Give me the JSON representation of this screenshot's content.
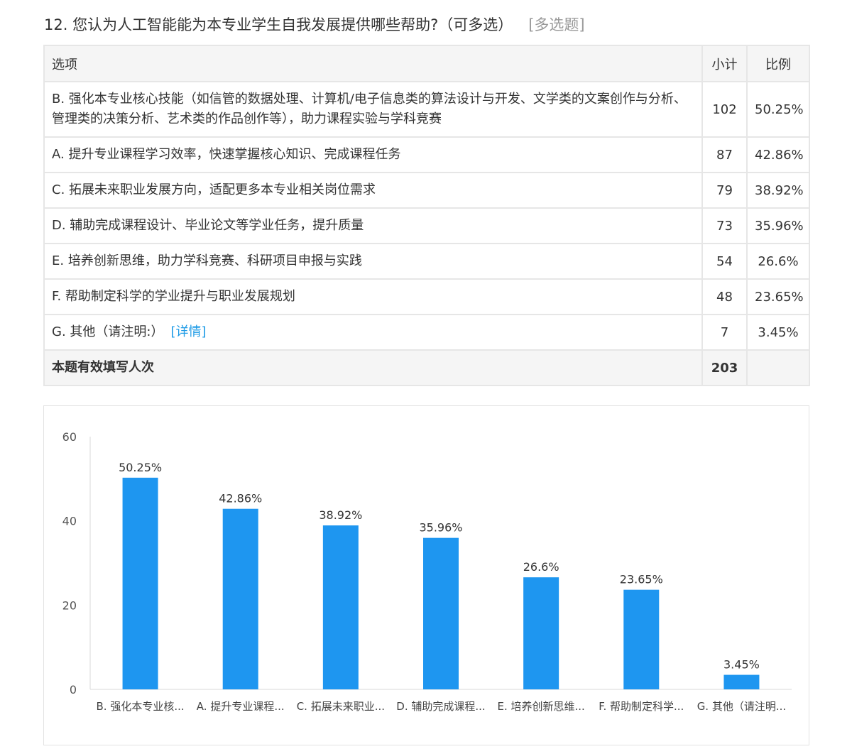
{
  "question": {
    "title": "12. 您认为人工智能能为本专业学生自我发展提供哪些帮助?（可多选）",
    "type_tag": "[多选题]"
  },
  "table": {
    "headers": {
      "option": "选项",
      "count": "小计",
      "ratio": "比例"
    },
    "rows": [
      {
        "option": "B. 强化本专业核心技能（如信管的数据处理、计算机/电子信息类的算法设计与开发、文学类的文案创作与分析、管理类的决策分析、艺术类的作品创作等），助力课程实验与学科竞赛",
        "count": "102",
        "ratio": "50.25%",
        "detail": ""
      },
      {
        "option": "A. 提升专业课程学习效率，快速掌握核心知识、完成课程任务",
        "count": "87",
        "ratio": "42.86%",
        "detail": ""
      },
      {
        "option": "C. 拓展未来职业发展方向，适配更多本专业相关岗位需求",
        "count": "79",
        "ratio": "38.92%",
        "detail": ""
      },
      {
        "option": "D. 辅助完成课程设计、毕业论文等学业任务，提升质量",
        "count": "73",
        "ratio": "35.96%",
        "detail": ""
      },
      {
        "option": "E. 培养创新思维，助力学科竞赛、科研项目申报与实践",
        "count": "54",
        "ratio": "26.6%",
        "detail": ""
      },
      {
        "option": "F. 帮助制定科学的学业提升与职业发展规划",
        "count": "48",
        "ratio": "23.65%",
        "detail": ""
      },
      {
        "option": "G. 其他（请注明:）",
        "count": "7",
        "ratio": "3.45%",
        "detail": "[详情]"
      }
    ],
    "total": {
      "label": "本题有效填写人次",
      "count": "203",
      "ratio": ""
    }
  },
  "colors": {
    "bar": "#1e96f0",
    "link": "#1e9be6",
    "muted": "#999999"
  },
  "chart_data": {
    "type": "bar",
    "categories": [
      "B. 强化本专业核...",
      "A. 提升专业课程...",
      "C. 拓展未来职业...",
      "D. 辅助完成课程...",
      "E. 培养创新思维...",
      "F. 帮助制定科学...",
      "G. 其他（请注明..."
    ],
    "values": [
      50.25,
      42.86,
      38.92,
      35.96,
      26.6,
      23.65,
      3.45
    ],
    "data_labels": [
      "50.25%",
      "42.86%",
      "38.92%",
      "35.96%",
      "26.6%",
      "23.65%",
      "3.45%"
    ],
    "yticks": [
      "0",
      "20",
      "40",
      "60"
    ],
    "ylim": [
      0,
      60
    ],
    "grid": false,
    "title": "",
    "xlabel": "",
    "ylabel": ""
  }
}
